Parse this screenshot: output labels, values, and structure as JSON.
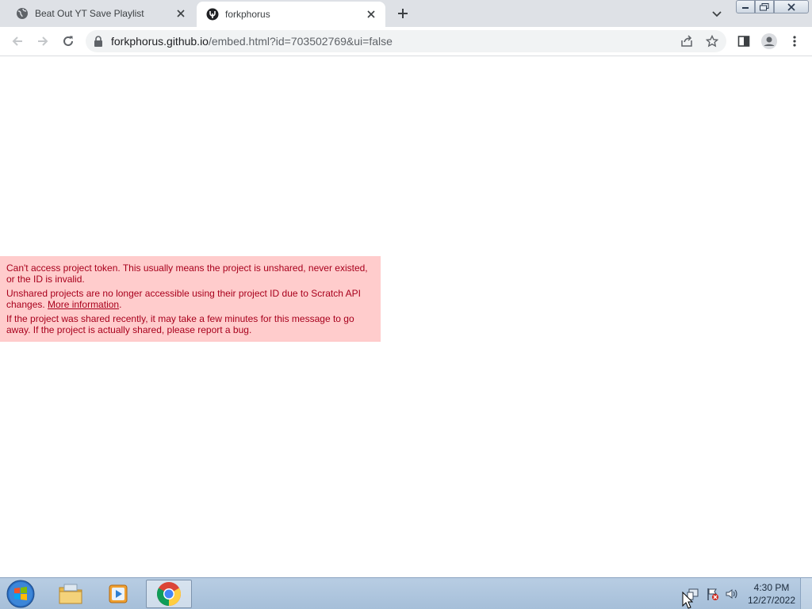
{
  "tabs": [
    {
      "title": "Beat Out YT Save Playlist",
      "favicon": "globe-icon",
      "active": false
    },
    {
      "title": "forkphorus",
      "favicon": "forkphorus-icon",
      "active": true
    }
  ],
  "address_bar": {
    "domain": "forkphorus.github.io",
    "path": "/embed.html?id=703502769&ui=false"
  },
  "error": {
    "line1": "Can't access project token. This usually means the project is unshared, never existed, or the ID is invalid.",
    "line2_text": "Unshared projects are no longer accessible using their project ID due to Scratch API changes. ",
    "line2_link": "More information",
    "line2_end": ".",
    "line3": "If the project was shared recently, it may take a few minutes for this message to go away. If the project is actually shared, please report a bug."
  },
  "taskbar": {
    "apps": [
      "file-explorer-icon",
      "media-player-icon",
      "chrome-icon"
    ],
    "clock_time": "4:30 PM",
    "clock_date": "12/27/2022"
  },
  "colors": {
    "error_bg": "#ffcccc",
    "error_text": "#a8001c",
    "tabstrip_bg": "#dee1e6"
  }
}
